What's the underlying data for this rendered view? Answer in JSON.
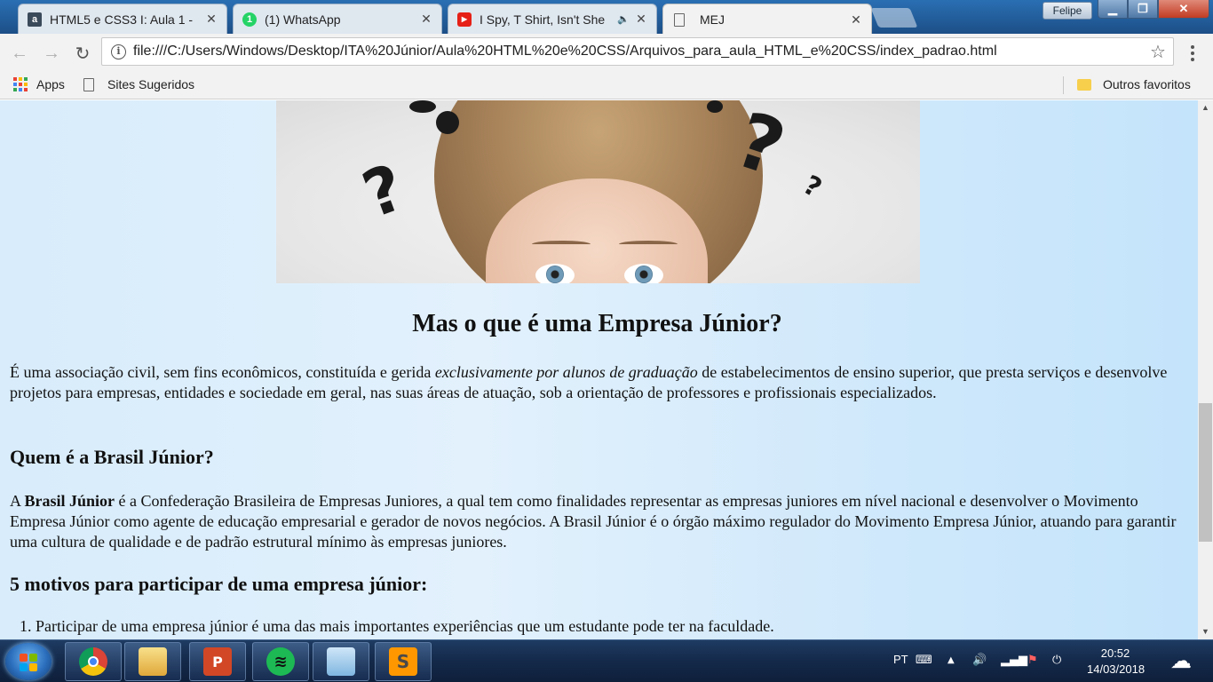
{
  "browser": {
    "tabs": [
      {
        "title": "HTML5 e CSS3 I: Aula 1 -",
        "favicon": "alura-icon",
        "active": false
      },
      {
        "title": "(1) WhatsApp",
        "favicon": "whatsapp-icon",
        "badge": "1",
        "active": false
      },
      {
        "title": "I Spy, T Shirt, Isn't She",
        "favicon": "youtube-icon",
        "active": false,
        "audio": true
      },
      {
        "title": "MEJ",
        "favicon": "page-icon",
        "active": true
      }
    ],
    "profile_name": "Felipe",
    "url": "file:///C:/Users/Windows/Desktop/ITA%20Júnior/Aula%20HTML%20e%20CSS/Arquivos_para_aula_HTML_e%20CSS/index_padrao.html",
    "bookmarks": {
      "apps": "Apps",
      "sites": "Sites Sugeridos",
      "others": "Outros favoritos"
    },
    "colors": {
      "tabstrip": "#1f5a96",
      "toolbar": "#f2f2f2"
    }
  },
  "page": {
    "title": "Mas o que é uma Empresa Júnior?",
    "intro": {
      "before": "É uma associação civil, sem fins econômicos, constituída e gerida ",
      "emphasis": "exclusivamente por alunos de graduação",
      "after": " de estabelecimentos de ensino superior, que presta serviços e desenvolve projetos para empresas, entidades e sociedade em geral, nas suas áreas de atuação, sob a orientação de professores e profissionais especializados."
    },
    "section2_title": "Quem é a Brasil Júnior?",
    "section2": {
      "before": "A ",
      "strong": "Brasil Júnior",
      "after": " é a Confederação Brasileira de Empresas Juniores, a qual tem como finalidades representar as empresas juniores em nível nacional e desenvolver o Movimento Empresa Júnior como agente de educação empresarial e gerador de novos negócios. A Brasil Júnior é o órgão máximo regulador do Movimento Empresa Júnior, atuando para garantir uma cultura de qualidade e de padrão estrutural mínimo às empresas juniores."
    },
    "section3_title": "5 motivos para participar de uma empresa júnior:",
    "reasons": [
      "Participar de uma empresa júnior é uma das mais importantes experiências que um estudante pode ter na faculdade."
    ],
    "background_color": "#d8ecfb"
  },
  "taskbar": {
    "apps": [
      "chrome-icon",
      "explorer-icon",
      "powerpoint-icon",
      "spotify-icon",
      "notepad-icon",
      "sublime-icon"
    ],
    "language": "PT",
    "time": "20:52",
    "date": "14/03/2018"
  }
}
